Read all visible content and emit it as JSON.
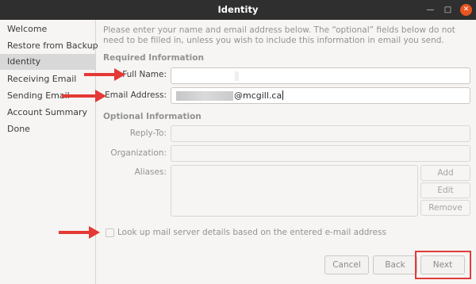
{
  "window": {
    "title": "Identity"
  },
  "sidebar": {
    "items": [
      {
        "label": "Welcome"
      },
      {
        "label": "Restore from Backup"
      },
      {
        "label": "Identity"
      },
      {
        "label": "Receiving Email"
      },
      {
        "label": "Sending Email"
      },
      {
        "label": "Account Summary"
      },
      {
        "label": "Done"
      }
    ]
  },
  "content": {
    "intro": "Please enter your name and email address below. The “optional” fields below do not need to be filled in, unless you wish to include this information in email you send.",
    "required_heading": "Required Information",
    "optional_heading": "Optional Information",
    "full_name": {
      "label": "Full Name:",
      "value": ""
    },
    "email": {
      "label": "Email Address:",
      "value_visible": "@mcgill.ca"
    },
    "reply_to": {
      "label": "Reply-To:"
    },
    "organization": {
      "label": "Organization:"
    },
    "aliases": {
      "label": "Aliases:",
      "add": "Add",
      "edit": "Edit",
      "remove": "Remove"
    },
    "lookup_checkbox": {
      "label": "Look up mail server details based on the entered e-mail address",
      "checked": false
    }
  },
  "footer": {
    "cancel": "Cancel",
    "back": "Back",
    "next": "Next"
  },
  "colors": {
    "annotation_red": "#e53935",
    "titlebar": "#2f2f2f",
    "close_button": "#e95420"
  }
}
